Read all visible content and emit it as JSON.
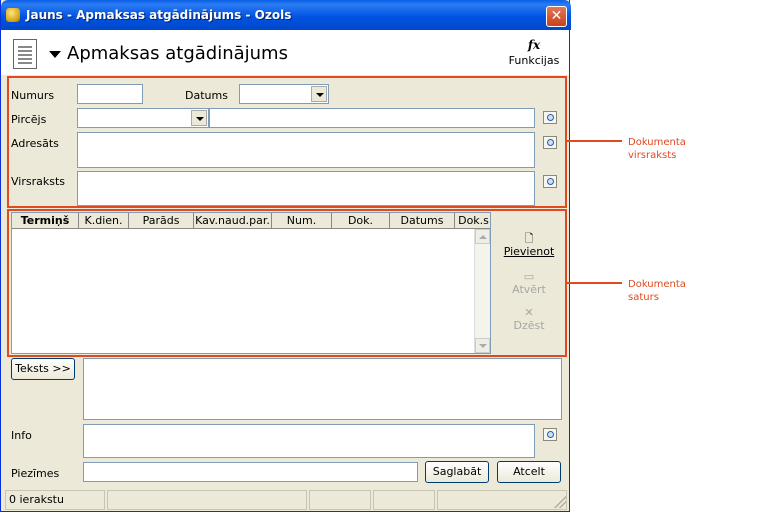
{
  "window": {
    "title": "Jauns - Apmaksas atgādinājums - Ozols",
    "close_glyph": "✕"
  },
  "header": {
    "title": "Apmaksas atgādinājums",
    "functions_label": "Funkcijas",
    "functions_icon": "fx"
  },
  "form": {
    "numurs_label": "Numurs",
    "numurs_value": "",
    "datums_label": "Datums",
    "datums_value": "",
    "pircejs_label": "Pircējs",
    "pircejs_value": "",
    "pircejs_name": "",
    "adresats_label": "Adresāts",
    "adresats_value": "",
    "virsraksts_label": "Virsraksts",
    "virsraksts_value": ""
  },
  "grid": {
    "columns": [
      "Termiņš",
      "K.dien.",
      "Parāds",
      "Kav.naud.par.",
      "Num.",
      "Dok.",
      "Datums",
      "Dok.s"
    ],
    "rows": []
  },
  "side_buttons": {
    "add": "Pievienot",
    "open": "Atvērt",
    "delete": "Dzēst"
  },
  "lower": {
    "text_button": "Teksts >>",
    "text_value": "",
    "info_label": "Info",
    "info_value": "",
    "notes_label": "Piezīmes",
    "notes_value": "",
    "save_button": "Saglabāt",
    "cancel_button": "Atcelt"
  },
  "status": {
    "records": "0 ierakstu"
  },
  "callouts": {
    "header_label": "Dokumenta virsraksts",
    "content_label": "Dokumenta saturs"
  },
  "colors": {
    "accent": "#e04a1f",
    "titlebar": "#0054e3",
    "window_bg": "#ece9d8"
  }
}
